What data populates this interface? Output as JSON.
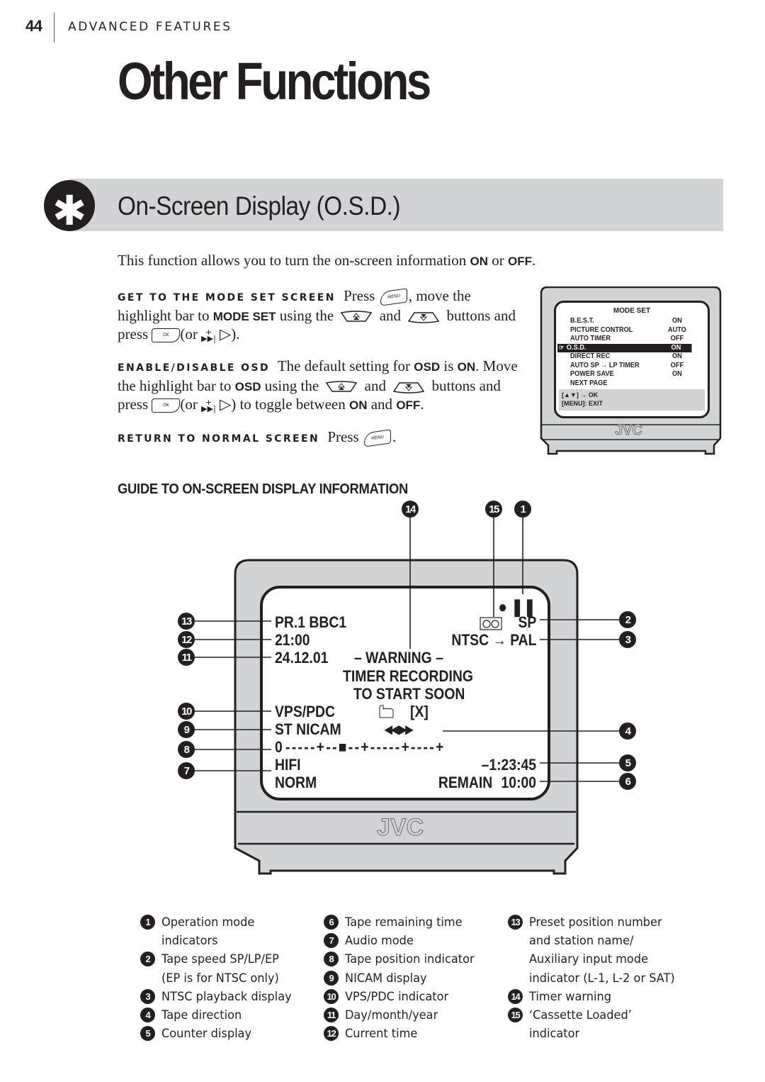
{
  "header": {
    "page_number": "44",
    "section": "ADVANCED FEATURES"
  },
  "page_title": "Other Functions",
  "banner": {
    "icon": "asterisk-icon",
    "title": "On-Screen Display (O.S.D.)"
  },
  "intro": {
    "text_before": "This function allows you to turn the on-screen information ",
    "on": "ON",
    "or": " or ",
    "off": "OFF",
    "end": "."
  },
  "steps": [
    {
      "heading": "GET TO THE MODE SET SCREEN",
      "parts": {
        "press": "Press",
        "move": ", move the highlight bar to",
        "target": "MODE SET",
        "using": "using the",
        "and": "and",
        "buttons_press": "buttons and press",
        "or_open": "(or",
        "close": ")."
      }
    },
    {
      "heading": "ENABLE/DISABLE OSD",
      "parts": {
        "default": "The default setting for",
        "osd": "OSD",
        "is": "is",
        "on": "ON",
        "move": ". Move the highlight bar to",
        "osd2": "OSD",
        "using": "using the",
        "and": "and",
        "buttons_and": "buttons and press",
        "or_open": "(or",
        "toggle": ") to toggle between",
        "on2": "ON",
        "and2": "and",
        "off": "OFF",
        "end": "."
      }
    },
    {
      "heading": "RETURN TO NORMAL SCREEN",
      "parts": {
        "press": "Press",
        "end": "."
      }
    }
  ],
  "buttons": {
    "menu": "MENU",
    "ok": "OK",
    "up": "up-arrow-button-icon",
    "down": "down-arrow-button-icon",
    "ffw_plus": "+",
    "ffw": "▶▶|",
    "play": "▷"
  },
  "mode_set_screen": {
    "title": "MODE SET",
    "rows": [
      {
        "label": "B.E.S.T.",
        "value": "ON",
        "selected": false
      },
      {
        "label": "PICTURE CONTROL",
        "value": "AUTO",
        "selected": false
      },
      {
        "label": "AUTO TIMER",
        "value": "OFF",
        "selected": false
      },
      {
        "label": "O.S.D.",
        "value": "ON",
        "selected": true
      },
      {
        "label": "DIRECT REC",
        "value": "ON",
        "selected": false
      },
      {
        "label": "AUTO SP → LP TIMER",
        "value": "OFF",
        "selected": false
      },
      {
        "label": "POWER SAVE",
        "value": "ON",
        "selected": false
      },
      {
        "label": "NEXT PAGE",
        "value": "",
        "selected": false
      }
    ],
    "footer_line1": "[▲▼] → OK",
    "footer_line2": "[MENU]: EXIT",
    "brand": "JVC"
  },
  "guide": {
    "heading": "GUIDE TO ON-SCREEN DISPLAY INFORMATION",
    "osd": {
      "preset": "PR.1 BBC1",
      "time": "21:00",
      "date": "24.12.01",
      "warning_line1": "– WARNING –",
      "warning_line2": "TIMER RECORDING",
      "warning_line3": "TO START SOON",
      "vps_pdc": "VPS/PDC",
      "nicam": "ST NICAM",
      "tape_position_start": "0",
      "tape_position_bar": "-----+--■--+-----+----+",
      "audio_mode": "HIFI",
      "norm": "NORM",
      "tape_speed": "SP",
      "ntsc_pal": "NTSC → PAL",
      "x_mark": "[X]",
      "direction": "◀◀ ▶▶",
      "counter": "–1:23:45",
      "remain_label": "REMAIN",
      "remain_time": "10:00",
      "op_record": "●",
      "op_pause": "❚❚"
    },
    "brand": "JVC",
    "callouts": [
      "1",
      "2",
      "3",
      "4",
      "5",
      "6",
      "7",
      "8",
      "9",
      "10",
      "11",
      "12",
      "13",
      "14",
      "15"
    ]
  },
  "legend": {
    "columns": [
      [
        {
          "num": "1",
          "lines": [
            "Operation mode",
            "indicators"
          ]
        },
        {
          "num": "2",
          "lines": [
            "Tape speed SP/LP/EP",
            "(EP is for NTSC only)"
          ]
        },
        {
          "num": "3",
          "lines": [
            "NTSC playback display"
          ]
        },
        {
          "num": "4",
          "lines": [
            "Tape direction"
          ]
        },
        {
          "num": "5",
          "lines": [
            "Counter display"
          ]
        }
      ],
      [
        {
          "num": "6",
          "lines": [
            "Tape remaining time"
          ]
        },
        {
          "num": "7",
          "lines": [
            "Audio mode"
          ]
        },
        {
          "num": "8",
          "lines": [
            "Tape position indicator"
          ]
        },
        {
          "num": "9",
          "lines": [
            "NICAM display"
          ]
        },
        {
          "num": "10",
          "lines": [
            "VPS/PDC indicator"
          ]
        },
        {
          "num": "11",
          "lines": [
            "Day/month/year"
          ]
        },
        {
          "num": "12",
          "lines": [
            "Current time"
          ]
        }
      ],
      [
        {
          "num": "13",
          "lines": [
            "Preset position number",
            "and station name/",
            "Auxiliary input mode",
            "indicator (L-1, L-2 or SAT)"
          ]
        },
        {
          "num": "14",
          "lines": [
            "Timer warning"
          ]
        },
        {
          "num": "15",
          "lines": [
            "‘Cassette Loaded’",
            "indicator"
          ]
        }
      ]
    ]
  }
}
